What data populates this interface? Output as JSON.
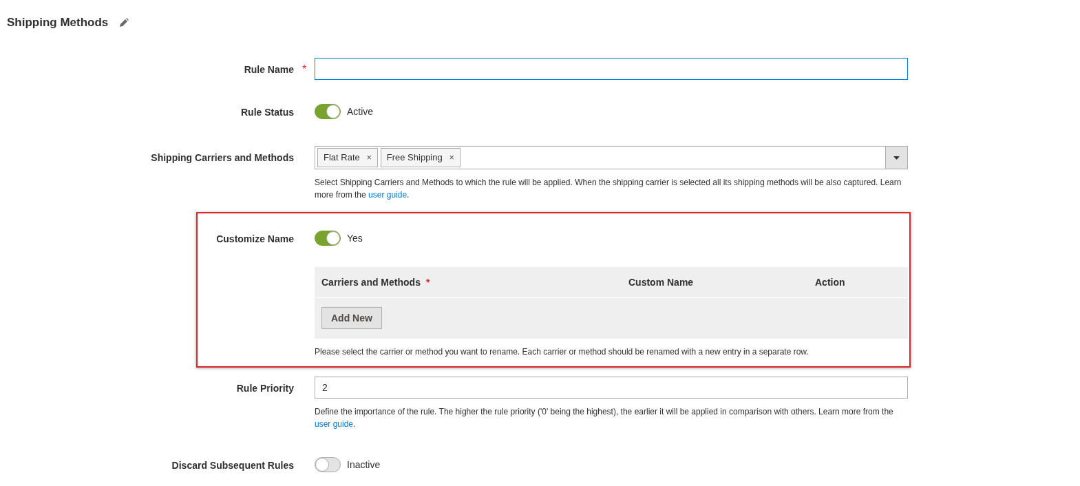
{
  "page_title": "Shipping Methods",
  "fields": [
    {
      "kind": "text",
      "label": "Rule Name",
      "required_mark": "*",
      "focused": true
    },
    {
      "kind": "toggle",
      "label": "Rule Status",
      "on": true,
      "state_text": "Active"
    },
    {
      "kind": "multiselect",
      "label": "Shipping Carriers and Methods",
      "tags": [
        {
          "label": "Flat Rate",
          "remove": "×"
        },
        {
          "label": "Free Shipping",
          "remove": "×"
        }
      ],
      "note": {
        "text": "Select Shipping Carriers and Methods to which the rule will be applied. When the shipping carrier is selected all its shipping methods will be also captured. Learn more from the ",
        "link": "user guide",
        "after": "."
      }
    },
    {
      "kind": "customize",
      "label": "Customize Name",
      "on": true,
      "state_text": "Yes",
      "highlighted": true,
      "grid": {
        "columns": [
          {
            "label": "Carriers and Methods",
            "required_mark": "*"
          },
          {
            "label": "Custom Name"
          },
          {
            "label": "Action"
          }
        ],
        "add_button": "Add New"
      },
      "note": {
        "text": "Please select the carrier or method you want to rename. Each carrier or method should be renamed with a new entry in a separate row."
      }
    },
    {
      "kind": "text",
      "label": "Rule Priority",
      "focused": false,
      "value": "2",
      "note": {
        "text": "Define the importance of the rule. The higher the rule priority ('0' being the highest), the earlier it will be applied in comparison with others. Learn more from the ",
        "link": "user guide",
        "after": "."
      }
    },
    {
      "kind": "toggle",
      "label": "Discard Subsequent Rules",
      "on": false,
      "state_text": "Inactive"
    }
  ]
}
